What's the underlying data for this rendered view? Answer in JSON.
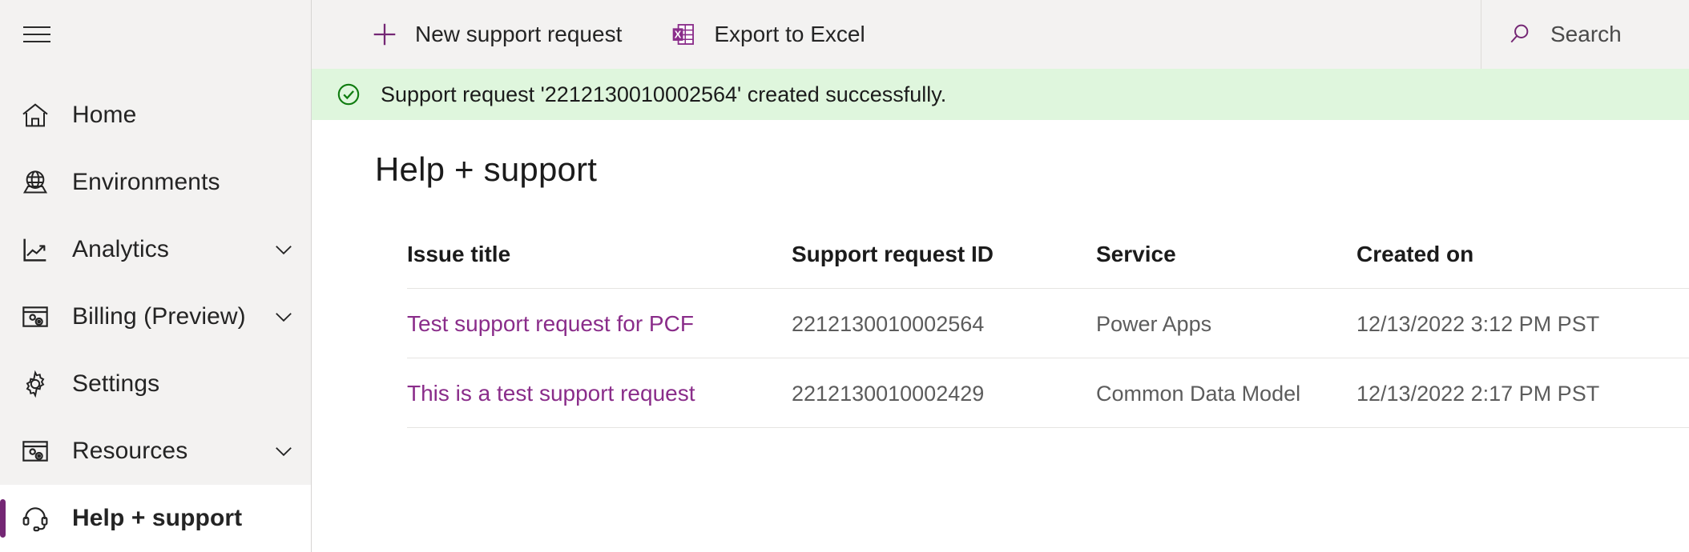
{
  "colors": {
    "accent_purple": "#742774",
    "link_purple": "#8a2d8a",
    "sidebar_bg": "#f3f2f1",
    "banner_bg": "#dff6dd",
    "banner_icon_green": "#107c10",
    "excel_icon": "#8a2d8a"
  },
  "sidebar": {
    "menu_icon": "hamburger-icon",
    "items": [
      {
        "label": "Home",
        "icon": "home-icon",
        "chevron": false,
        "selected": false
      },
      {
        "label": "Environments",
        "icon": "globe-icon",
        "chevron": false,
        "selected": false
      },
      {
        "label": "Analytics",
        "icon": "chart-icon",
        "chevron": true,
        "selected": false
      },
      {
        "label": "Billing (Preview)",
        "icon": "billing-icon",
        "chevron": true,
        "selected": false
      },
      {
        "label": "Settings",
        "icon": "gear-icon",
        "chevron": false,
        "selected": false
      },
      {
        "label": "Resources",
        "icon": "resources-icon",
        "chevron": true,
        "selected": false
      },
      {
        "label": "Help + support",
        "icon": "headset-icon",
        "chevron": false,
        "selected": true
      }
    ]
  },
  "commandbar": {
    "new_request_label": "New support request",
    "new_request_icon": "plus-icon",
    "export_label": "Export to Excel",
    "export_icon": "excel-icon"
  },
  "search": {
    "placeholder": "Search",
    "icon": "search-icon"
  },
  "banner": {
    "icon": "check-circle-icon",
    "message": "Support request '2212130010002564' created successfully."
  },
  "page": {
    "title": "Help + support"
  },
  "table": {
    "columns": [
      "Issue title",
      "Support request ID",
      "Service",
      "Created on"
    ],
    "rows": [
      {
        "title": "Test support request for PCF",
        "id": "2212130010002564",
        "service": "Power Apps",
        "created": "12/13/2022 3:12 PM PST"
      },
      {
        "title": "This is a test support request",
        "id": "2212130010002429",
        "service": "Common Data Model",
        "created": "12/13/2022 2:17 PM PST"
      }
    ]
  }
}
